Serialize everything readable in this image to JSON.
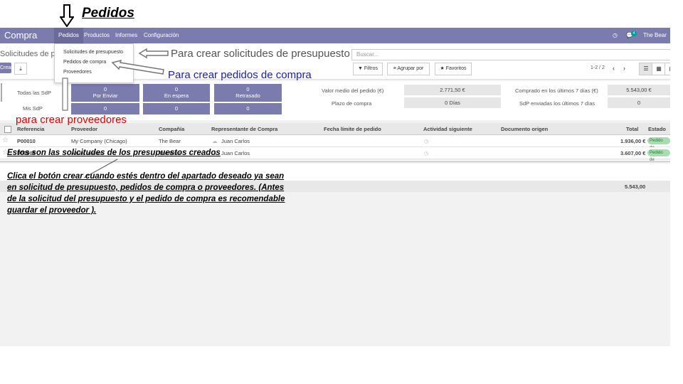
{
  "annotations": {
    "top_title": "Pedidos",
    "solicitudes": "Para crear solicitudes de presupuesto",
    "pedidos": "Para crear pedidos de compra",
    "proveedores": "para crear proveedores",
    "presupuestos_creados": "Estos  son las solicitudes  de los presupuestos  creados",
    "instrucciones": "Clica el botón crear cuando estés dentro del apartado deseado ya sean en solicitud de presupuesto,  pedidos de compra o proveedores.  (Antes de la solicitud del presupuesto  y el pedido de compra es recomendable guardar el proveedor )."
  },
  "navbar": {
    "brand": "Compra",
    "items": [
      "Pedidos",
      "Productos",
      "Informes",
      "Configuración"
    ],
    "active": "Pedidos",
    "messages_count": "4",
    "user": "The Bear"
  },
  "dropdown": {
    "items": [
      "Solicitudes de presupuesto",
      "Pedidos de compra",
      "Proveedores"
    ]
  },
  "control_panel": {
    "breadcrumb": "Solicitudes de presupuesto",
    "create_label": "Crear",
    "search_placeholder": "Buscar...",
    "filters_label": "Filtros",
    "group_label": "Agrupar por",
    "favorites_label": "Favoritos",
    "pager": "1-2 / 2"
  },
  "dashboard": {
    "row_labels": [
      "Todas las SdP",
      "Mis SdP"
    ],
    "columns": [
      {
        "label": "Por Enviar",
        "all": "0",
        "mine": "0"
      },
      {
        "label": "En espera",
        "all": "0",
        "mine": "0"
      },
      {
        "label": "Retrasado",
        "all": "0",
        "mine": "0"
      }
    ],
    "stats_left": [
      {
        "label": "Valor medio del pedido (€)",
        "value": "2.771,50 €"
      },
      {
        "label": "Plazo de compra",
        "value": "0  Días"
      }
    ],
    "stats_right": [
      {
        "label": "Comprado en los últimos 7 días (€)",
        "value": "5.543,00 €"
      },
      {
        "label": "SdP enviadas los últimos 7 días",
        "value": "0"
      }
    ]
  },
  "table": {
    "headers": [
      "Referencia",
      "Proveedor",
      "Compañía",
      "Representante de Compra",
      "Fecha límite de pedido",
      "Actividad siguiente",
      "Documento origen",
      "Total",
      "Estado"
    ],
    "rows": [
      {
        "ref": "P00010",
        "vendor": "My Company (Chicago)",
        "company": "The Bear",
        "rep": "Juan Carlos",
        "total": "1.936,00 €",
        "status": "Pedido de"
      },
      {
        "ref": "P00009",
        "vendor": "Azure Interior",
        "company": "The Bear",
        "rep": "Juan Carlos",
        "total": "3.607,00 €",
        "status": "Pedido de"
      }
    ],
    "footer_total": "5.543,00"
  }
}
